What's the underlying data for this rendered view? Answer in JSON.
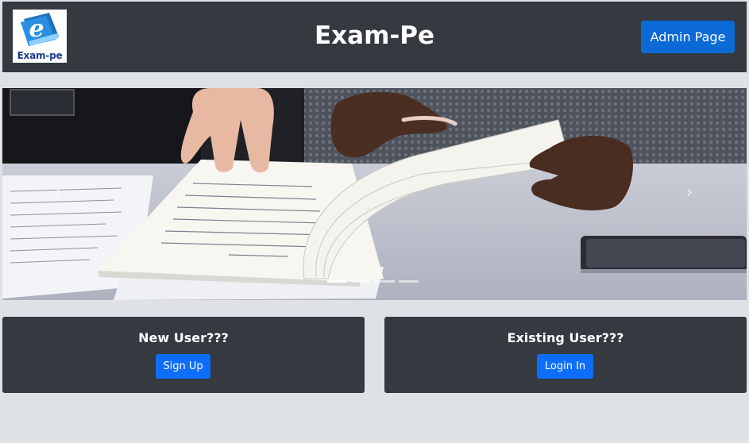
{
  "header": {
    "logo_text": "Exam-pe",
    "title": "Exam-Pe",
    "admin_button": "Admin Page"
  },
  "carousel": {
    "prev_icon": "chevron-left-icon",
    "next_icon": "chevron-right-icon",
    "slide_count": 4,
    "active_slide": 1
  },
  "cards": {
    "new_user": {
      "title": "New User???",
      "button": "Sign Up"
    },
    "existing_user": {
      "title": "Existing User???",
      "button": "Login In"
    }
  },
  "colors": {
    "header_bg": "#343a40",
    "page_bg": "#dee2e6",
    "primary": "#0d6efd"
  }
}
